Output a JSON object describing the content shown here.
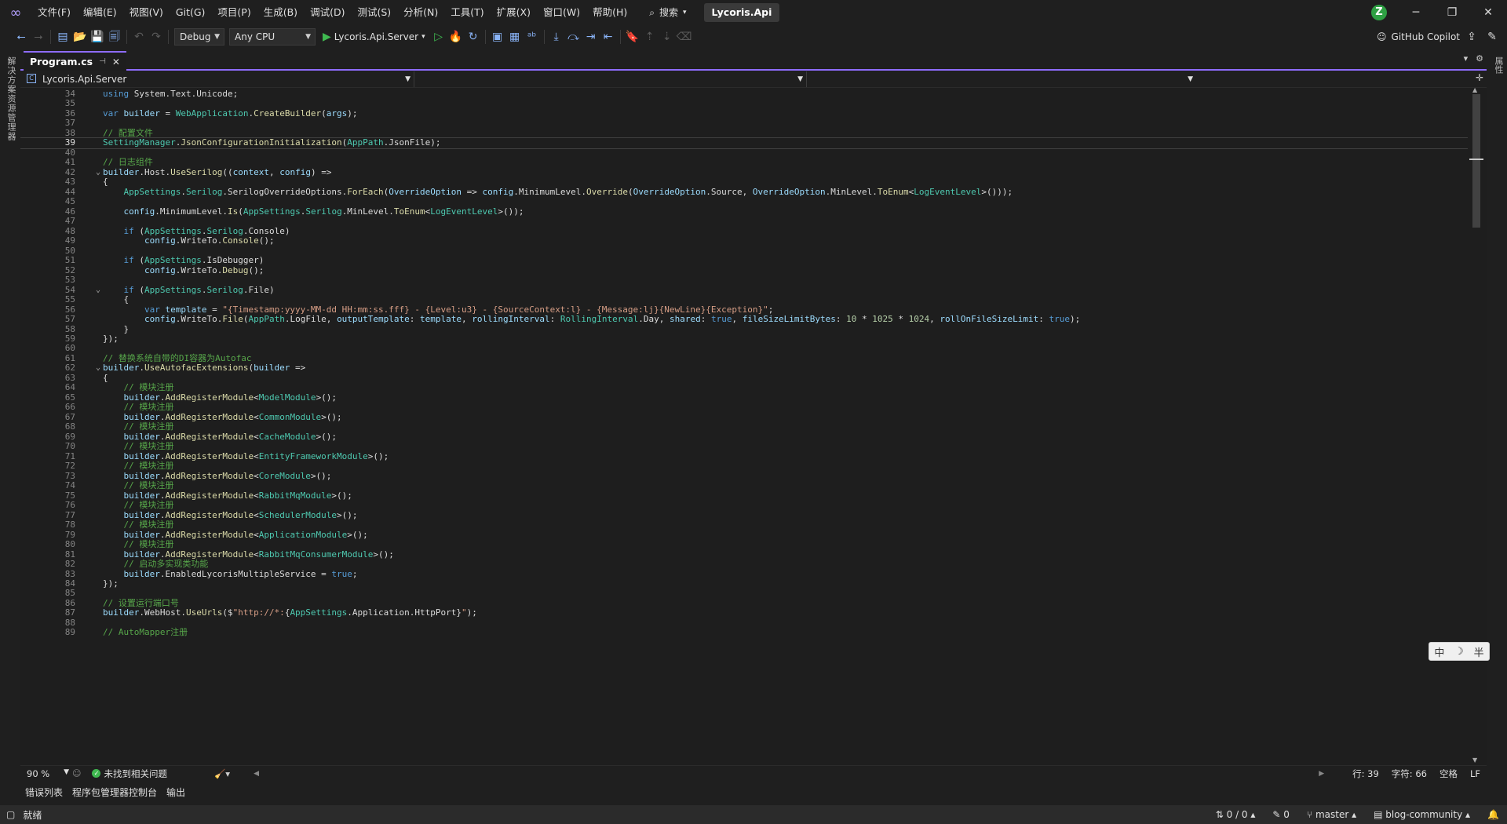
{
  "app": {
    "solution_name": "Lycoris.Api",
    "avatar_initial": "Z"
  },
  "menu": [
    "文件(F)",
    "编辑(E)",
    "视图(V)",
    "Git(G)",
    "项目(P)",
    "生成(B)",
    "调试(D)",
    "测试(S)",
    "分析(N)",
    "工具(T)",
    "扩展(X)",
    "窗口(W)",
    "帮助(H)"
  ],
  "search_label": "搜索",
  "toolbar": {
    "configuration": "Debug",
    "platform": "Any CPU",
    "startup_project": "Lycoris.Api.Server",
    "copilot_label": "GitHub Copilot"
  },
  "left_strip_label": "解决方案资源管理器",
  "right_strip_label": "属性",
  "tab": {
    "title": "Program.cs"
  },
  "navbar": {
    "project": "Lycoris.Api.Server"
  },
  "editor": {
    "current_line": 39,
    "lines": [
      {
        "n": 34,
        "t": [
          [
            "k",
            "using"
          ],
          [
            "p",
            " System.Text.Unicode;"
          ]
        ]
      },
      {
        "n": 35,
        "t": []
      },
      {
        "n": 36,
        "t": [
          [
            "k",
            "var"
          ],
          [
            "p",
            " "
          ],
          [
            "v",
            "builder"
          ],
          [
            "p",
            " = "
          ],
          [
            "y",
            "WebApplication"
          ],
          [
            "p",
            "."
          ],
          [
            "m",
            "CreateBuilder"
          ],
          [
            "p",
            "("
          ],
          [
            "v",
            "args"
          ],
          [
            "p",
            ");"
          ]
        ]
      },
      {
        "n": 37,
        "t": []
      },
      {
        "n": 38,
        "t": [
          [
            "c",
            "// 配置文件"
          ]
        ]
      },
      {
        "n": 39,
        "t": [
          [
            "y",
            "SettingManager"
          ],
          [
            "p",
            "."
          ],
          [
            "m",
            "JsonConfigurationInitialization"
          ],
          [
            "p",
            "("
          ],
          [
            "y",
            "AppPath"
          ],
          [
            "p",
            ".JsonFile);"
          ]
        ]
      },
      {
        "n": 40,
        "t": []
      },
      {
        "n": 41,
        "t": [
          [
            "c",
            "// 日志组件"
          ]
        ]
      },
      {
        "n": 42,
        "f": true,
        "t": [
          [
            "v",
            "builder"
          ],
          [
            "p",
            ".Host."
          ],
          [
            "m",
            "UseSerilog"
          ],
          [
            "p",
            "(("
          ],
          [
            "v",
            "context"
          ],
          [
            "p",
            ", "
          ],
          [
            "v",
            "config"
          ],
          [
            "p",
            ") =>"
          ]
        ]
      },
      {
        "n": 43,
        "t": [
          [
            "p",
            "{"
          ]
        ]
      },
      {
        "n": 44,
        "t": [
          [
            "p",
            "    "
          ],
          [
            "y",
            "AppSettings"
          ],
          [
            "p",
            "."
          ],
          [
            "y",
            "Serilog"
          ],
          [
            "p",
            ".SerilogOverrideOptions."
          ],
          [
            "m",
            "ForEach"
          ],
          [
            "p",
            "("
          ],
          [
            "v",
            "OverrideOption"
          ],
          [
            "p",
            " => "
          ],
          [
            "v",
            "config"
          ],
          [
            "p",
            ".MinimumLevel."
          ],
          [
            "m",
            "Override"
          ],
          [
            "p",
            "("
          ],
          [
            "v",
            "OverrideOption"
          ],
          [
            "p",
            ".Source, "
          ],
          [
            "v",
            "OverrideOption"
          ],
          [
            "p",
            ".MinLevel."
          ],
          [
            "m",
            "ToEnum"
          ],
          [
            "p",
            "<"
          ],
          [
            "y",
            "LogEventLevel"
          ],
          [
            "p",
            ">()));"
          ]
        ]
      },
      {
        "n": 45,
        "t": []
      },
      {
        "n": 46,
        "t": [
          [
            "p",
            "    "
          ],
          [
            "v",
            "config"
          ],
          [
            "p",
            ".MinimumLevel."
          ],
          [
            "m",
            "Is"
          ],
          [
            "p",
            "("
          ],
          [
            "y",
            "AppSettings"
          ],
          [
            "p",
            "."
          ],
          [
            "y",
            "Serilog"
          ],
          [
            "p",
            ".MinLevel."
          ],
          [
            "m",
            "ToEnum"
          ],
          [
            "p",
            "<"
          ],
          [
            "y",
            "LogEventLevel"
          ],
          [
            "p",
            ">());"
          ]
        ]
      },
      {
        "n": 47,
        "t": []
      },
      {
        "n": 48,
        "t": [
          [
            "p",
            "    "
          ],
          [
            "k",
            "if"
          ],
          [
            "p",
            " ("
          ],
          [
            "y",
            "AppSettings"
          ],
          [
            "p",
            "."
          ],
          [
            "y",
            "Serilog"
          ],
          [
            "p",
            ".Console)"
          ]
        ]
      },
      {
        "n": 49,
        "t": [
          [
            "p",
            "        "
          ],
          [
            "v",
            "config"
          ],
          [
            "p",
            ".WriteTo."
          ],
          [
            "m",
            "Console"
          ],
          [
            "p",
            "();"
          ]
        ]
      },
      {
        "n": 50,
        "t": []
      },
      {
        "n": 51,
        "t": [
          [
            "p",
            "    "
          ],
          [
            "k",
            "if"
          ],
          [
            "p",
            " ("
          ],
          [
            "y",
            "AppSettings"
          ],
          [
            "p",
            ".IsDebugger)"
          ]
        ]
      },
      {
        "n": 52,
        "t": [
          [
            "p",
            "        "
          ],
          [
            "v",
            "config"
          ],
          [
            "p",
            ".WriteTo."
          ],
          [
            "m",
            "Debug"
          ],
          [
            "p",
            "();"
          ]
        ]
      },
      {
        "n": 53,
        "t": []
      },
      {
        "n": 54,
        "f": true,
        "t": [
          [
            "p",
            "    "
          ],
          [
            "k",
            "if"
          ],
          [
            "p",
            " ("
          ],
          [
            "y",
            "AppSettings"
          ],
          [
            "p",
            "."
          ],
          [
            "y",
            "Serilog"
          ],
          [
            "p",
            ".File)"
          ]
        ]
      },
      {
        "n": 55,
        "t": [
          [
            "p",
            "    {"
          ]
        ]
      },
      {
        "n": 56,
        "t": [
          [
            "p",
            "        "
          ],
          [
            "k",
            "var"
          ],
          [
            "p",
            " "
          ],
          [
            "v",
            "template"
          ],
          [
            "p",
            " = "
          ],
          [
            "s",
            "\"{Timestamp:yyyy-MM-dd HH:mm:ss.fff} - {Level:u3} - {SourceContext:l} - {Message:lj}{NewLine}{Exception}\""
          ],
          [
            "p",
            ";"
          ]
        ]
      },
      {
        "n": 57,
        "t": [
          [
            "p",
            "        "
          ],
          [
            "v",
            "config"
          ],
          [
            "p",
            ".WriteTo."
          ],
          [
            "m",
            "File"
          ],
          [
            "p",
            "("
          ],
          [
            "y",
            "AppPath"
          ],
          [
            "p",
            ".LogFile, "
          ],
          [
            "v",
            "outputTemplate"
          ],
          [
            "p",
            ": "
          ],
          [
            "v",
            "template"
          ],
          [
            "p",
            ", "
          ],
          [
            "v",
            "rollingInterval"
          ],
          [
            "p",
            ": "
          ],
          [
            "y",
            "RollingInterval"
          ],
          [
            "p",
            ".Day, "
          ],
          [
            "v",
            "shared"
          ],
          [
            "p",
            ": "
          ],
          [
            "k",
            "true"
          ],
          [
            "p",
            ", "
          ],
          [
            "v",
            "fileSizeLimitBytes"
          ],
          [
            "p",
            ": "
          ],
          [
            "n",
            "10"
          ],
          [
            "p",
            " * "
          ],
          [
            "n",
            "1025"
          ],
          [
            "p",
            " * "
          ],
          [
            "n",
            "1024"
          ],
          [
            "p",
            ", "
          ],
          [
            "v",
            "rollOnFileSizeLimit"
          ],
          [
            "p",
            ": "
          ],
          [
            "k",
            "true"
          ],
          [
            "p",
            ");"
          ]
        ]
      },
      {
        "n": 58,
        "t": [
          [
            "p",
            "    }"
          ]
        ]
      },
      {
        "n": 59,
        "t": [
          [
            "p",
            "});"
          ]
        ]
      },
      {
        "n": 60,
        "t": []
      },
      {
        "n": 61,
        "t": [
          [
            "c",
            "// 替换系统自带的DI容器为Autofac"
          ]
        ]
      },
      {
        "n": 62,
        "f": true,
        "t": [
          [
            "v",
            "builder"
          ],
          [
            "p",
            "."
          ],
          [
            "m",
            "UseAutofacExtensions"
          ],
          [
            "p",
            "("
          ],
          [
            "v",
            "builder"
          ],
          [
            "p",
            " =>"
          ]
        ]
      },
      {
        "n": 63,
        "t": [
          [
            "p",
            "{"
          ]
        ]
      },
      {
        "n": 64,
        "t": [
          [
            "p",
            "    "
          ],
          [
            "c",
            "// 模块注册"
          ]
        ]
      },
      {
        "n": 65,
        "t": [
          [
            "p",
            "    "
          ],
          [
            "v",
            "builder"
          ],
          [
            "p",
            "."
          ],
          [
            "m",
            "AddRegisterModule"
          ],
          [
            "p",
            "<"
          ],
          [
            "y",
            "ModelModule"
          ],
          [
            "p",
            ">();"
          ]
        ]
      },
      {
        "n": 66,
        "t": [
          [
            "p",
            "    "
          ],
          [
            "c",
            "// 模块注册"
          ]
        ]
      },
      {
        "n": 67,
        "t": [
          [
            "p",
            "    "
          ],
          [
            "v",
            "builder"
          ],
          [
            "p",
            "."
          ],
          [
            "m",
            "AddRegisterModule"
          ],
          [
            "p",
            "<"
          ],
          [
            "y",
            "CommonModule"
          ],
          [
            "p",
            ">();"
          ]
        ]
      },
      {
        "n": 68,
        "t": [
          [
            "p",
            "    "
          ],
          [
            "c",
            "// 模块注册"
          ]
        ]
      },
      {
        "n": 69,
        "t": [
          [
            "p",
            "    "
          ],
          [
            "v",
            "builder"
          ],
          [
            "p",
            "."
          ],
          [
            "m",
            "AddRegisterModule"
          ],
          [
            "p",
            "<"
          ],
          [
            "y",
            "CacheModule"
          ],
          [
            "p",
            ">();"
          ]
        ]
      },
      {
        "n": 70,
        "t": [
          [
            "p",
            "    "
          ],
          [
            "c",
            "// 模块注册"
          ]
        ]
      },
      {
        "n": 71,
        "t": [
          [
            "p",
            "    "
          ],
          [
            "v",
            "builder"
          ],
          [
            "p",
            "."
          ],
          [
            "m",
            "AddRegisterModule"
          ],
          [
            "p",
            "<"
          ],
          [
            "y",
            "EntityFrameworkModule"
          ],
          [
            "p",
            ">();"
          ]
        ]
      },
      {
        "n": 72,
        "t": [
          [
            "p",
            "    "
          ],
          [
            "c",
            "// 模块注册"
          ]
        ]
      },
      {
        "n": 73,
        "t": [
          [
            "p",
            "    "
          ],
          [
            "v",
            "builder"
          ],
          [
            "p",
            "."
          ],
          [
            "m",
            "AddRegisterModule"
          ],
          [
            "p",
            "<"
          ],
          [
            "y",
            "CoreModule"
          ],
          [
            "p",
            ">();"
          ]
        ]
      },
      {
        "n": 74,
        "t": [
          [
            "p",
            "    "
          ],
          [
            "c",
            "// 模块注册"
          ]
        ]
      },
      {
        "n": 75,
        "t": [
          [
            "p",
            "    "
          ],
          [
            "v",
            "builder"
          ],
          [
            "p",
            "."
          ],
          [
            "m",
            "AddRegisterModule"
          ],
          [
            "p",
            "<"
          ],
          [
            "y",
            "RabbitMqModule"
          ],
          [
            "p",
            ">();"
          ]
        ]
      },
      {
        "n": 76,
        "t": [
          [
            "p",
            "    "
          ],
          [
            "c",
            "// 模块注册"
          ]
        ]
      },
      {
        "n": 77,
        "t": [
          [
            "p",
            "    "
          ],
          [
            "v",
            "builder"
          ],
          [
            "p",
            "."
          ],
          [
            "m",
            "AddRegisterModule"
          ],
          [
            "p",
            "<"
          ],
          [
            "y",
            "SchedulerModule"
          ],
          [
            "p",
            ">();"
          ]
        ]
      },
      {
        "n": 78,
        "t": [
          [
            "p",
            "    "
          ],
          [
            "c",
            "// 模块注册"
          ]
        ]
      },
      {
        "n": 79,
        "t": [
          [
            "p",
            "    "
          ],
          [
            "v",
            "builder"
          ],
          [
            "p",
            "."
          ],
          [
            "m",
            "AddRegisterModule"
          ],
          [
            "p",
            "<"
          ],
          [
            "y",
            "ApplicationModule"
          ],
          [
            "p",
            ">();"
          ]
        ]
      },
      {
        "n": 80,
        "t": [
          [
            "p",
            "    "
          ],
          [
            "c",
            "// 模块注册"
          ]
        ]
      },
      {
        "n": 81,
        "t": [
          [
            "p",
            "    "
          ],
          [
            "v",
            "builder"
          ],
          [
            "p",
            "."
          ],
          [
            "m",
            "AddRegisterModule"
          ],
          [
            "p",
            "<"
          ],
          [
            "y",
            "RabbitMqConsumerModule"
          ],
          [
            "p",
            ">();"
          ]
        ]
      },
      {
        "n": 82,
        "t": [
          [
            "p",
            "    "
          ],
          [
            "c",
            "// 启动多实现类功能"
          ]
        ]
      },
      {
        "n": 83,
        "t": [
          [
            "p",
            "    "
          ],
          [
            "v",
            "builder"
          ],
          [
            "p",
            ".EnabledLycorisMultipleService = "
          ],
          [
            "k",
            "true"
          ],
          [
            "p",
            ";"
          ]
        ]
      },
      {
        "n": 84,
        "t": [
          [
            "p",
            "});"
          ]
        ]
      },
      {
        "n": 85,
        "t": []
      },
      {
        "n": 86,
        "t": [
          [
            "c",
            "// 设置运行端口号"
          ]
        ]
      },
      {
        "n": 87,
        "t": [
          [
            "v",
            "builder"
          ],
          [
            "p",
            ".WebHost."
          ],
          [
            "m",
            "UseUrls"
          ],
          [
            "p",
            "($"
          ],
          [
            "s",
            "\"http://*:"
          ],
          [
            "p",
            "{"
          ],
          [
            "y",
            "AppSettings"
          ],
          [
            "p",
            ".Application.HttpPort}"
          ],
          [
            "s",
            "\""
          ],
          [
            "p",
            ");"
          ]
        ]
      },
      {
        "n": 88,
        "t": []
      },
      {
        "n": 89,
        "t": [
          [
            "c",
            "// AutoMapper注册"
          ]
        ]
      }
    ]
  },
  "ime": {
    "chars": [
      "中",
      "☽",
      "半"
    ]
  },
  "editor_status": {
    "zoom": "90 %",
    "issues": "未找到相关问题",
    "line": "行: 39",
    "char": "字符: 66",
    "whitespace": "空格",
    "eol": "LF"
  },
  "panel_tabs": [
    "错误列表",
    "程序包管理器控制台",
    "输出"
  ],
  "statusbar": {
    "ready": "就绪",
    "sync": "0 / 0",
    "changes": "0",
    "branch": "master",
    "repo": "blog-community"
  }
}
